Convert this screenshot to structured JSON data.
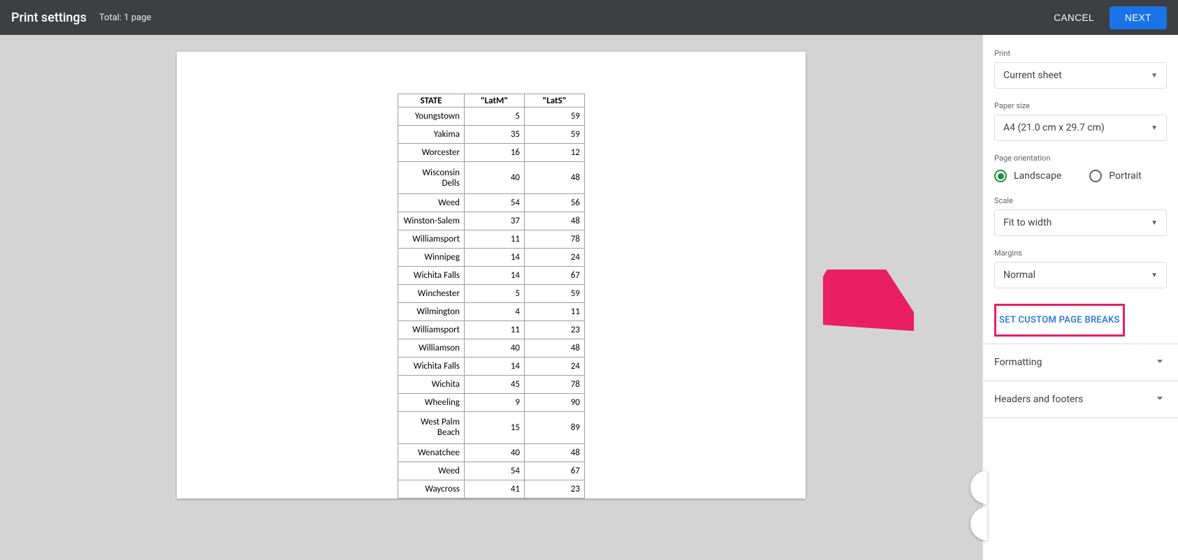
{
  "header": {
    "title": "Print settings",
    "subtitle": "Total: 1 page",
    "cancel": "CANCEL",
    "next": "NEXT"
  },
  "table": {
    "headers": [
      "STATE",
      "\"LatM\"",
      "\"LatS\""
    ],
    "rows": [
      [
        "Youngstown",
        "5",
        "59"
      ],
      [
        "Yakima",
        "35",
        "59"
      ],
      [
        "Worcester",
        "16",
        "12"
      ],
      [
        "Wisconsin Dells",
        "40",
        "48"
      ],
      [
        "Weed",
        "54",
        "56"
      ],
      [
        "Winston-Salem",
        "37",
        "48"
      ],
      [
        "Williamsport",
        "11",
        "78"
      ],
      [
        "Winnipeg",
        "14",
        "24"
      ],
      [
        "Wichita Falls",
        "14",
        "67"
      ],
      [
        "Winchester",
        "5",
        "59"
      ],
      [
        "Wilmington",
        "4",
        "11"
      ],
      [
        "Williamsport",
        "11",
        "23"
      ],
      [
        "Williamson",
        "40",
        "48"
      ],
      [
        "Wichita Falls",
        "14",
        "24"
      ],
      [
        "Wichita",
        "45",
        "78"
      ],
      [
        "Wheeling",
        "9",
        "90"
      ],
      [
        "West Palm Beach",
        "15",
        "89"
      ],
      [
        "Wenatchee",
        "40",
        "48"
      ],
      [
        "Weed",
        "54",
        "67"
      ],
      [
        "Waycross",
        "41",
        "23"
      ]
    ]
  },
  "sidebar": {
    "print_label": "Print",
    "print_value": "Current sheet",
    "paper_label": "Paper size",
    "paper_value": "A4 (21.0 cm x 29.7 cm)",
    "orientation_label": "Page orientation",
    "landscape": "Landscape",
    "portrait": "Portrait",
    "scale_label": "Scale",
    "scale_value": "Fit to width",
    "margins_label": "Margins",
    "margins_value": "Normal",
    "custom_breaks": "SET CUSTOM PAGE BREAKS",
    "formatting": "Formatting",
    "headers_footers": "Headers and footers"
  }
}
